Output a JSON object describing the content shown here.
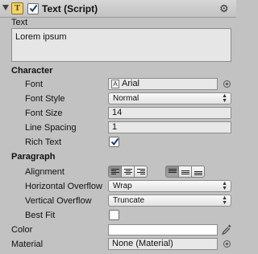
{
  "header": {
    "title": "Text (Script)",
    "enabled": true,
    "component_icon_letter": "T",
    "gear_icon": "gear-icon",
    "fold_icon": "foldout-arrow-icon"
  },
  "text_field": {
    "label": "Text",
    "value": "Lorem ipsum"
  },
  "character": {
    "section_label": "Character",
    "font": {
      "label": "Font",
      "value": "Arial",
      "icon": "font-asset-icon"
    },
    "font_style": {
      "label": "Font Style",
      "value": "Normal"
    },
    "font_size": {
      "label": "Font Size",
      "value": "14"
    },
    "line_spacing": {
      "label": "Line Spacing",
      "value": "1"
    },
    "rich_text": {
      "label": "Rich Text",
      "checked": true
    }
  },
  "paragraph": {
    "section_label": "Paragraph",
    "alignment": {
      "label": "Alignment",
      "horizontal": [
        "left",
        "center",
        "right"
      ],
      "horizontal_selected": "left",
      "vertical": [
        "top",
        "middle",
        "bottom"
      ],
      "vertical_selected": "top"
    },
    "horizontal_overflow": {
      "label": "Horizontal Overflow",
      "value": "Wrap"
    },
    "vertical_overflow": {
      "label": "Vertical Overflow",
      "value": "Truncate"
    },
    "best_fit": {
      "label": "Best Fit",
      "checked": false
    }
  },
  "color": {
    "label": "Color",
    "value": "#FFFFFF",
    "icon": "eyedropper-icon"
  },
  "material": {
    "label": "Material",
    "value": "None (Material)",
    "icon": "object-picker-icon"
  }
}
